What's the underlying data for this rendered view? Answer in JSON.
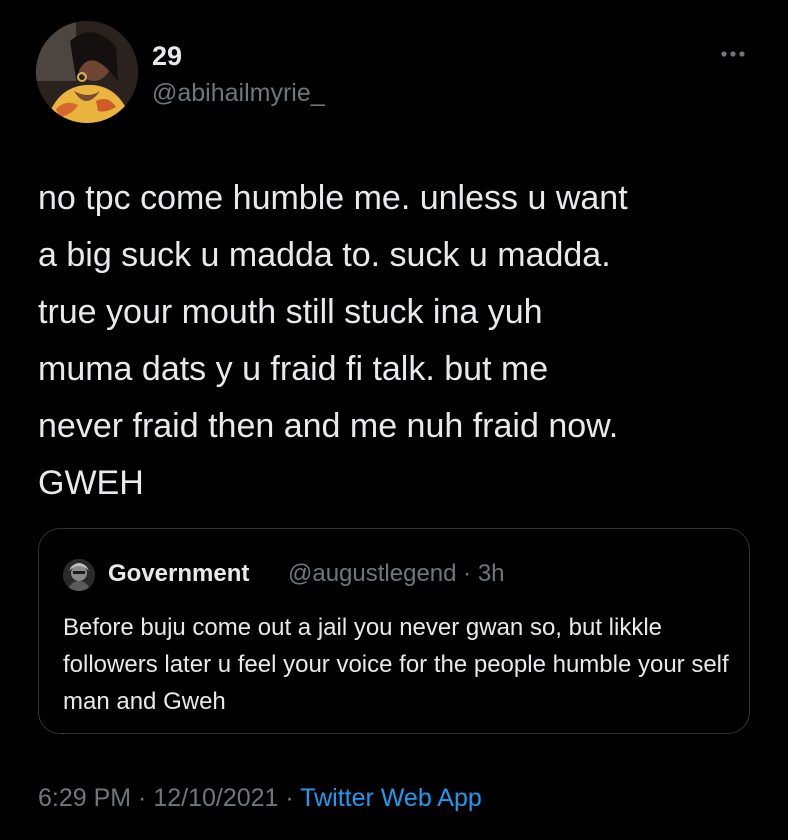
{
  "author": {
    "display_name": "29",
    "handle": "@abihailmyrie_"
  },
  "tweet": {
    "text": "no tpc come humble me. unless u want\na big suck u madda to. suck u madda.\ntrue your mouth still stuck ina yuh\nmuma dats y u fraid fi talk. but me\nnever fraid then and me nuh fraid now.\nGWEH"
  },
  "quoted_tweet": {
    "display_name": "Government",
    "handle_time": "@augustlegend · 3h",
    "text": "Before buju come out a jail you never gwan so, but likkle followers later u feel your voice for the people humble your self man and Gweh"
  },
  "meta": {
    "time": "6:29 PM",
    "sep1": " · ",
    "date": "12/10/2021",
    "sep2": " · ",
    "source": "Twitter Web App"
  },
  "icons": {
    "more": "more-horizontal-icon",
    "avatar": "avatar-photo",
    "quote_avatar": "avatar-photo"
  },
  "colors": {
    "background": "#000000",
    "primary_text": "#e7e9ea",
    "secondary_text": "#71767b",
    "link": "#1d9bf0",
    "border": "#2f3336"
  }
}
